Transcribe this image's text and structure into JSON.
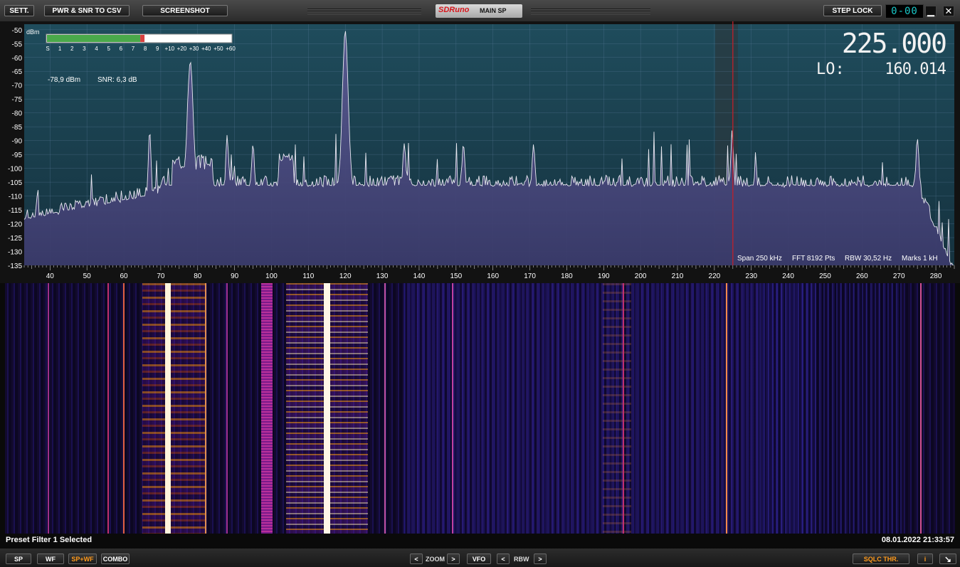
{
  "toolbar": {
    "settings_label": "SETT.",
    "pwr_snr_label": "PWR & SNR TO CSV",
    "screenshot_label": "SCREENSHOT",
    "app_name": "SDRuno",
    "window_title": "MAIN SP",
    "step_lock_label": "STEP LOCK",
    "display_readout": "0-00",
    "minimize_icon": "minimize-icon",
    "close_icon": "close-icon"
  },
  "spectrum": {
    "frequency": "225.000",
    "lo_label": "LO:",
    "lo_value": "160.014",
    "dbm_unit": "dBm",
    "smeter_scale": [
      "S",
      "1",
      "2",
      "3",
      "4",
      "5",
      "6",
      "7",
      "8",
      "9",
      "+10",
      "+20",
      "+30",
      "+40",
      "+50",
      "+60"
    ],
    "level_dbm": "-78,9 dBm",
    "snr": "SNR: 6,3 dB",
    "smeter_level_fraction": 0.51,
    "info_span": "Span 250 kHz",
    "info_fft": "FFT 8192 Pts",
    "info_rbw": "RBW 30,52 Hz",
    "info_marks": "Marks 1 kH",
    "y_ticks": [
      -50,
      -55,
      -60,
      -65,
      -70,
      -75,
      -80,
      -85,
      -90,
      -95,
      -100,
      -105,
      -110,
      -115,
      -120,
      -125,
      -130,
      -135
    ],
    "x_ticks": [
      40,
      50,
      60,
      70,
      80,
      90,
      100,
      110,
      120,
      130,
      140,
      150,
      160,
      170,
      180,
      190,
      200,
      210,
      220,
      230,
      240,
      250,
      260,
      270,
      280
    ],
    "x_range_khz": [
      33,
      285
    ],
    "y_range_dbm": [
      -135,
      -48
    ],
    "tuned_khz": 225.0,
    "peaks_khz_dbm": [
      [
        67,
        -85
      ],
      [
        78,
        -60
      ],
      [
        88,
        -87
      ],
      [
        95,
        -91
      ],
      [
        104,
        -94
      ],
      [
        120,
        -49
      ],
      [
        136,
        -89
      ],
      [
        152,
        -90
      ],
      [
        171,
        -91
      ],
      [
        224.8,
        -86
      ],
      [
        275,
        -88
      ]
    ],
    "noise_floor_dbm": -106,
    "colors": {
      "background": "#1e4a5a",
      "fill": "#4a4a80",
      "trace": "#e8e8f0",
      "marker": "#c0202a"
    }
  },
  "status": {
    "message": "Preset Filter 1 Selected",
    "datetime": "08.01.2022 21:33:57"
  },
  "bottom": {
    "sp_label": "SP",
    "wf_label": "WF",
    "spwf_label": "SP+WF",
    "combo_label": "COMBO",
    "zoom_label": "ZOOM",
    "vfo_label": "VFO",
    "rbw_label": "RBW",
    "sqlc_label": "SQLC THR.",
    "info_label": "i",
    "prev_glyph": "<",
    "next_glyph": ">",
    "resize_glyph": "↘"
  }
}
